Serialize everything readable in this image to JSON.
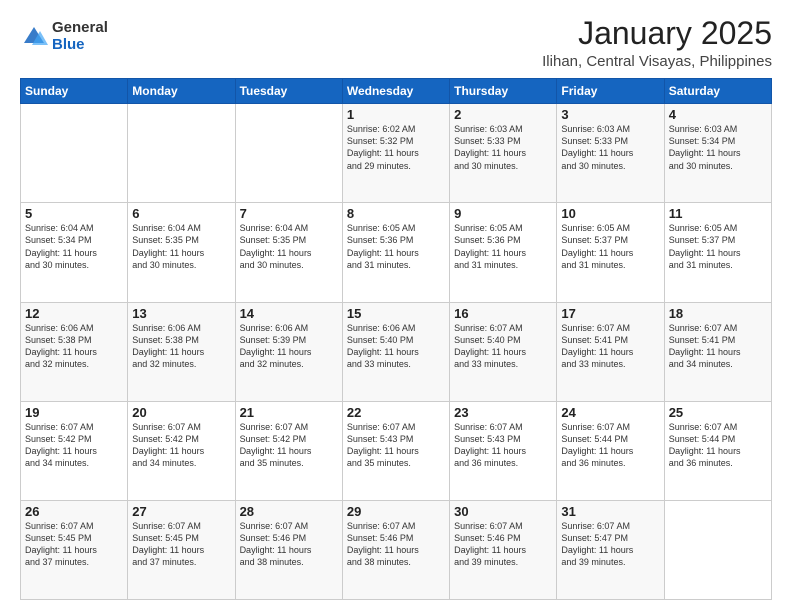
{
  "header": {
    "logo_general": "General",
    "logo_blue": "Blue",
    "title": "January 2025",
    "subtitle": "Ilihan, Central Visayas, Philippines"
  },
  "calendar": {
    "days_of_week": [
      "Sunday",
      "Monday",
      "Tuesday",
      "Wednesday",
      "Thursday",
      "Friday",
      "Saturday"
    ],
    "weeks": [
      [
        {
          "day": "",
          "info": ""
        },
        {
          "day": "",
          "info": ""
        },
        {
          "day": "",
          "info": ""
        },
        {
          "day": "1",
          "info": "Sunrise: 6:02 AM\nSunset: 5:32 PM\nDaylight: 11 hours\nand 29 minutes."
        },
        {
          "day": "2",
          "info": "Sunrise: 6:03 AM\nSunset: 5:33 PM\nDaylight: 11 hours\nand 30 minutes."
        },
        {
          "day": "3",
          "info": "Sunrise: 6:03 AM\nSunset: 5:33 PM\nDaylight: 11 hours\nand 30 minutes."
        },
        {
          "day": "4",
          "info": "Sunrise: 6:03 AM\nSunset: 5:34 PM\nDaylight: 11 hours\nand 30 minutes."
        }
      ],
      [
        {
          "day": "5",
          "info": "Sunrise: 6:04 AM\nSunset: 5:34 PM\nDaylight: 11 hours\nand 30 minutes."
        },
        {
          "day": "6",
          "info": "Sunrise: 6:04 AM\nSunset: 5:35 PM\nDaylight: 11 hours\nand 30 minutes."
        },
        {
          "day": "7",
          "info": "Sunrise: 6:04 AM\nSunset: 5:35 PM\nDaylight: 11 hours\nand 30 minutes."
        },
        {
          "day": "8",
          "info": "Sunrise: 6:05 AM\nSunset: 5:36 PM\nDaylight: 11 hours\nand 31 minutes."
        },
        {
          "day": "9",
          "info": "Sunrise: 6:05 AM\nSunset: 5:36 PM\nDaylight: 11 hours\nand 31 minutes."
        },
        {
          "day": "10",
          "info": "Sunrise: 6:05 AM\nSunset: 5:37 PM\nDaylight: 11 hours\nand 31 minutes."
        },
        {
          "day": "11",
          "info": "Sunrise: 6:05 AM\nSunset: 5:37 PM\nDaylight: 11 hours\nand 31 minutes."
        }
      ],
      [
        {
          "day": "12",
          "info": "Sunrise: 6:06 AM\nSunset: 5:38 PM\nDaylight: 11 hours\nand 32 minutes."
        },
        {
          "day": "13",
          "info": "Sunrise: 6:06 AM\nSunset: 5:38 PM\nDaylight: 11 hours\nand 32 minutes."
        },
        {
          "day": "14",
          "info": "Sunrise: 6:06 AM\nSunset: 5:39 PM\nDaylight: 11 hours\nand 32 minutes."
        },
        {
          "day": "15",
          "info": "Sunrise: 6:06 AM\nSunset: 5:40 PM\nDaylight: 11 hours\nand 33 minutes."
        },
        {
          "day": "16",
          "info": "Sunrise: 6:07 AM\nSunset: 5:40 PM\nDaylight: 11 hours\nand 33 minutes."
        },
        {
          "day": "17",
          "info": "Sunrise: 6:07 AM\nSunset: 5:41 PM\nDaylight: 11 hours\nand 33 minutes."
        },
        {
          "day": "18",
          "info": "Sunrise: 6:07 AM\nSunset: 5:41 PM\nDaylight: 11 hours\nand 34 minutes."
        }
      ],
      [
        {
          "day": "19",
          "info": "Sunrise: 6:07 AM\nSunset: 5:42 PM\nDaylight: 11 hours\nand 34 minutes."
        },
        {
          "day": "20",
          "info": "Sunrise: 6:07 AM\nSunset: 5:42 PM\nDaylight: 11 hours\nand 34 minutes."
        },
        {
          "day": "21",
          "info": "Sunrise: 6:07 AM\nSunset: 5:42 PM\nDaylight: 11 hours\nand 35 minutes."
        },
        {
          "day": "22",
          "info": "Sunrise: 6:07 AM\nSunset: 5:43 PM\nDaylight: 11 hours\nand 35 minutes."
        },
        {
          "day": "23",
          "info": "Sunrise: 6:07 AM\nSunset: 5:43 PM\nDaylight: 11 hours\nand 36 minutes."
        },
        {
          "day": "24",
          "info": "Sunrise: 6:07 AM\nSunset: 5:44 PM\nDaylight: 11 hours\nand 36 minutes."
        },
        {
          "day": "25",
          "info": "Sunrise: 6:07 AM\nSunset: 5:44 PM\nDaylight: 11 hours\nand 36 minutes."
        }
      ],
      [
        {
          "day": "26",
          "info": "Sunrise: 6:07 AM\nSunset: 5:45 PM\nDaylight: 11 hours\nand 37 minutes."
        },
        {
          "day": "27",
          "info": "Sunrise: 6:07 AM\nSunset: 5:45 PM\nDaylight: 11 hours\nand 37 minutes."
        },
        {
          "day": "28",
          "info": "Sunrise: 6:07 AM\nSunset: 5:46 PM\nDaylight: 11 hours\nand 38 minutes."
        },
        {
          "day": "29",
          "info": "Sunrise: 6:07 AM\nSunset: 5:46 PM\nDaylight: 11 hours\nand 38 minutes."
        },
        {
          "day": "30",
          "info": "Sunrise: 6:07 AM\nSunset: 5:46 PM\nDaylight: 11 hours\nand 39 minutes."
        },
        {
          "day": "31",
          "info": "Sunrise: 6:07 AM\nSunset: 5:47 PM\nDaylight: 11 hours\nand 39 minutes."
        },
        {
          "day": "",
          "info": ""
        }
      ]
    ]
  }
}
